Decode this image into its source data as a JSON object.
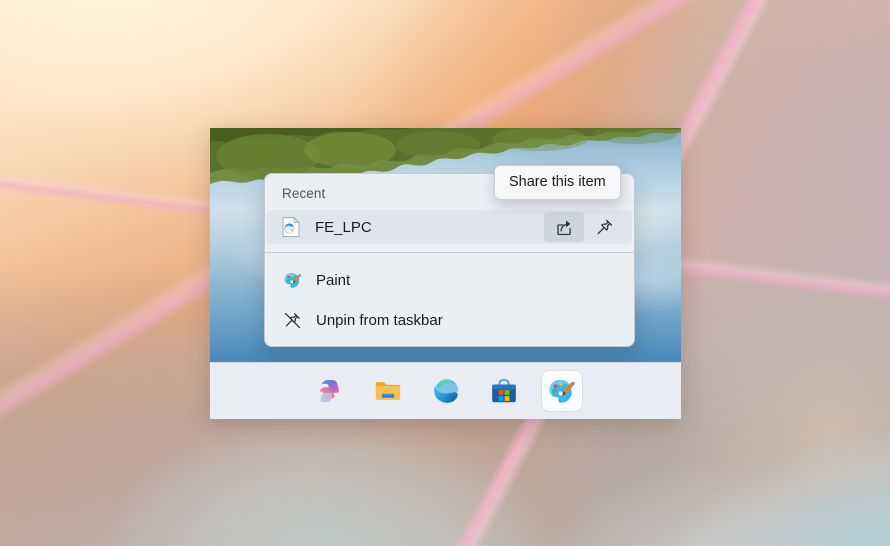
{
  "desktop": {
    "wallpaper_name": "abstract-pastel-wallpaper",
    "colors": {
      "cream": "#fde9cf",
      "peach": "#e8a87b",
      "mauve": "#c4b2b4",
      "pink_ribbon": "#f7b4cd",
      "taupe": "#b9aaa5",
      "cyan_haze": "#bad4da"
    }
  },
  "inner_window": {
    "wallpaper_name": "lake-sky-tree-reflection-wallpaper",
    "colors": {
      "sky_top": "#7fa8c4",
      "sky_bottom": "#2f76aa",
      "foliage": "#6f8a3c"
    }
  },
  "tooltip": {
    "text": "Share this item",
    "name": "share-this-item-tooltip"
  },
  "jumplist": {
    "header": "Recent",
    "recent": {
      "file_name": "FE_LPC",
      "file_icon": "paint-document-icon",
      "actions": [
        {
          "name": "share-button",
          "icon": "share-icon",
          "label": "Share this item",
          "state": "hovered"
        },
        {
          "name": "pin-button",
          "icon": "pin-icon",
          "label": "Pin to this list",
          "state": "default"
        }
      ]
    },
    "items": [
      {
        "label": "Paint",
        "icon": "paint-app-icon",
        "name": "jumplist-item-paint"
      },
      {
        "label": "Unpin from taskbar",
        "icon": "unpin-icon",
        "name": "jumplist-item-unpin-from-taskbar"
      }
    ],
    "colors": {
      "background": "#eaeff4",
      "row_highlight": "#dfe5ec",
      "action_hover": "#cdd5de",
      "separator": "#96a2b0",
      "header_text": "#4b5563",
      "item_text": "#1b1b1b"
    }
  },
  "taskbar": {
    "background": "#e9ecf2",
    "buttons": [
      {
        "name": "taskbar-button-copilot",
        "label": "Copilot",
        "icon": "copilot-icon",
        "active": false
      },
      {
        "name": "taskbar-button-file-explorer",
        "label": "File Explorer",
        "icon": "folder-icon",
        "active": false
      },
      {
        "name": "taskbar-button-edge",
        "label": "Microsoft Edge",
        "icon": "edge-icon",
        "active": false
      },
      {
        "name": "taskbar-button-microsoft-store",
        "label": "Microsoft Store",
        "icon": "store-icon",
        "active": false
      },
      {
        "name": "taskbar-button-paint",
        "label": "Paint",
        "icon": "paint-app-icon",
        "active": true
      }
    ]
  }
}
